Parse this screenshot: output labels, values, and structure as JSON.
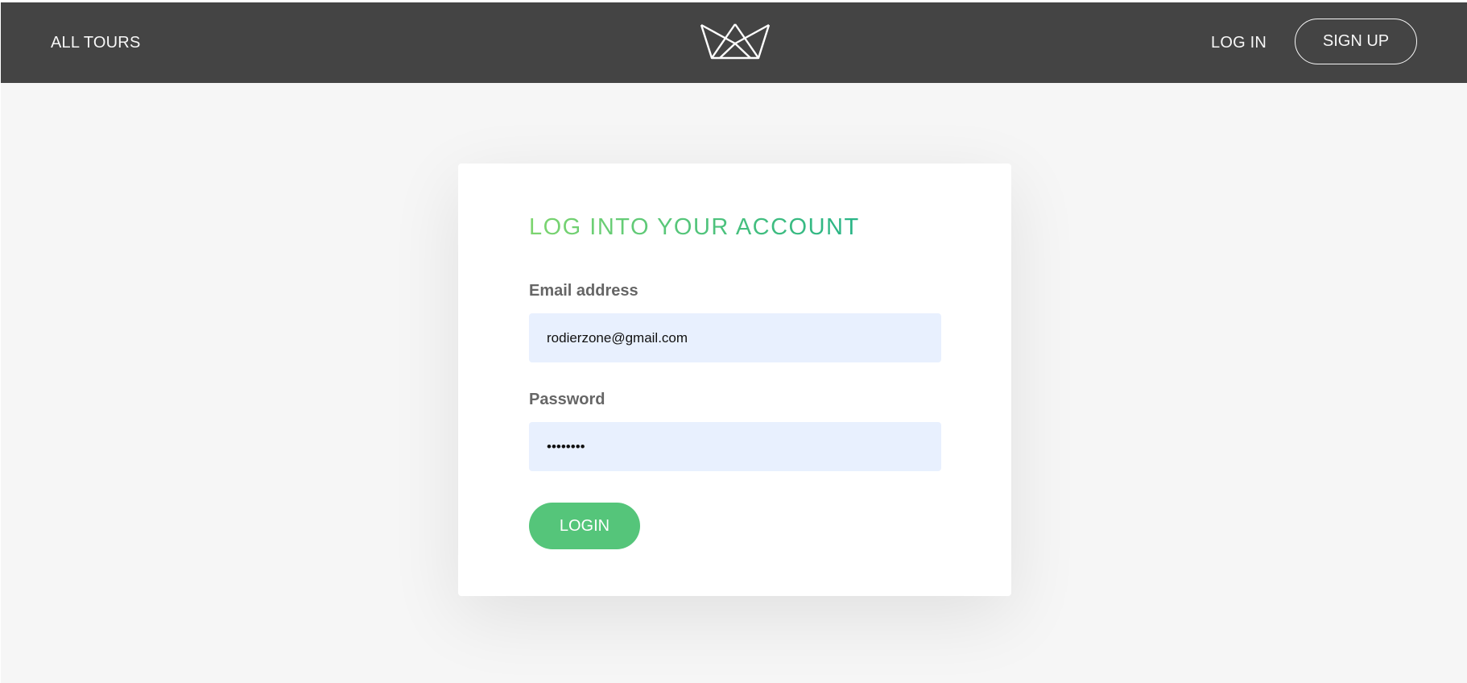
{
  "header": {
    "all_tours_label": "ALL TOURS",
    "logo_icon": "crown-logo-icon",
    "login_label": "LOG IN",
    "signup_label": "SIGN UP"
  },
  "login_form": {
    "title": "LOG INTO YOUR ACCOUNT",
    "email_label": "Email address",
    "email_value": "rodierzone@gmail.com",
    "password_label": "Password",
    "password_value": "password",
    "submit_label": "LOGIN"
  },
  "colors": {
    "navbar": "#444444",
    "page_background": "#f6f6f6",
    "accent_green": "#55c57a",
    "title_gradient_start": "#7dd56f",
    "title_gradient_end": "#28b487",
    "input_background": "#e8f0fe"
  }
}
